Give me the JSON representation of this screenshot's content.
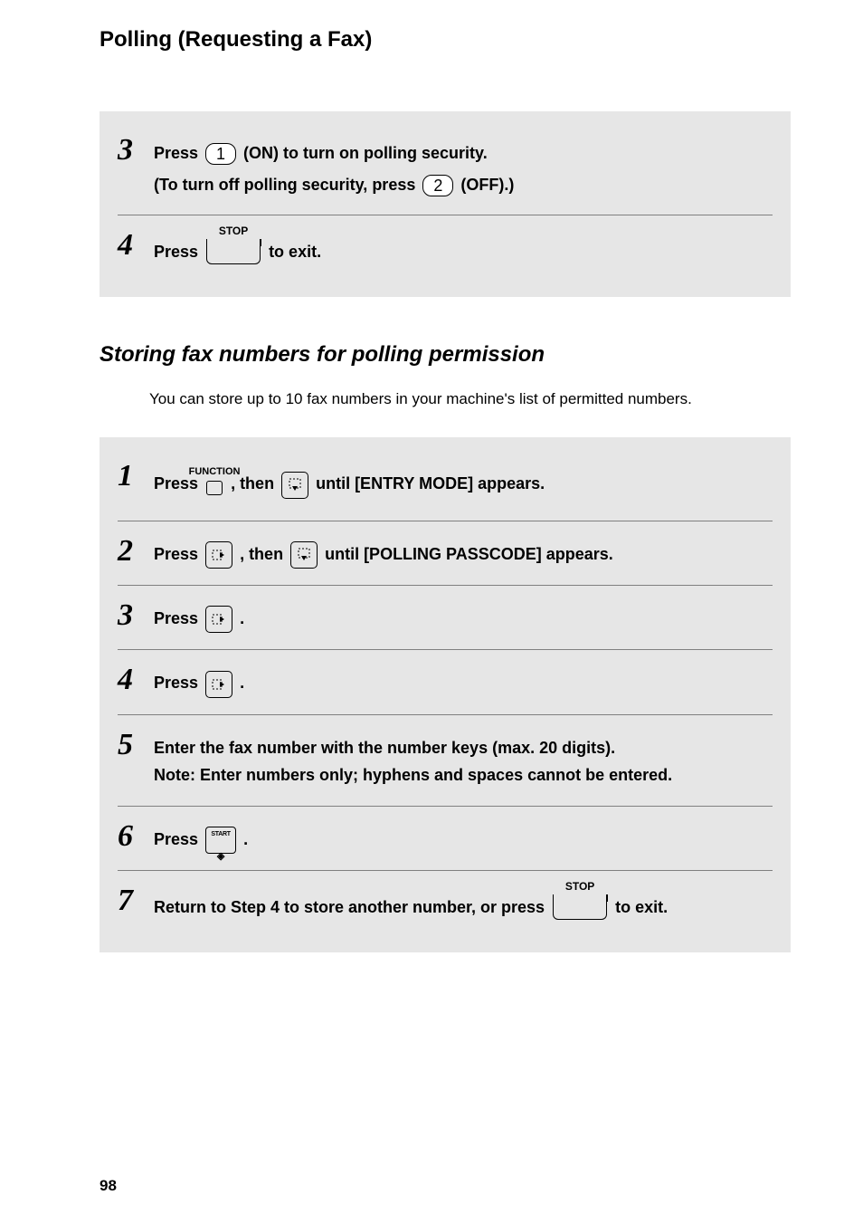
{
  "header": "Polling (Requesting a Fax)",
  "blockA": {
    "step3": {
      "num": "3",
      "line1_pre": "Press ",
      "line1_key": "1",
      "line1_post": " (ON) to turn on polling security.",
      "line2_pre": "(To turn off polling security, press ",
      "line2_key": "2",
      "line2_post": " (OFF).)"
    },
    "step4": {
      "num": "4",
      "pre": "Press ",
      "stop": "STOP",
      "post": " to exit."
    }
  },
  "subsection": "Storing fax numbers for polling permission",
  "intro": "You can store up to 10 fax numbers in your machine's list of permitted numbers.",
  "blockB": {
    "s1": {
      "num": "1",
      "pre": "Press ",
      "func": "FUNCTION",
      "mid": ", then ",
      "post": " until [ENTRY MODE] appears."
    },
    "s2": {
      "num": "2",
      "pre": "Press ",
      "mid": ", then ",
      "post": " until [POLLING PASSCODE] appears."
    },
    "s3": {
      "num": "3",
      "pre": "Press ",
      "post": "."
    },
    "s4": {
      "num": "4",
      "pre": "Press ",
      "post": "."
    },
    "s5": {
      "num": "5",
      "line1": "Enter the fax number with the number keys (max. 20 digits).",
      "line2": "Note: Enter numbers only; hyphens and spaces cannot be entered."
    },
    "s6": {
      "num": "6",
      "pre": "Press ",
      "start": "START",
      "post": "."
    },
    "s7": {
      "num": "7",
      "pre": "Return to Step 4 to store another number, or press ",
      "stop": "STOP",
      "post": " to exit."
    }
  },
  "pageNumber": "98",
  "icons": {
    "diamond": "◈"
  }
}
